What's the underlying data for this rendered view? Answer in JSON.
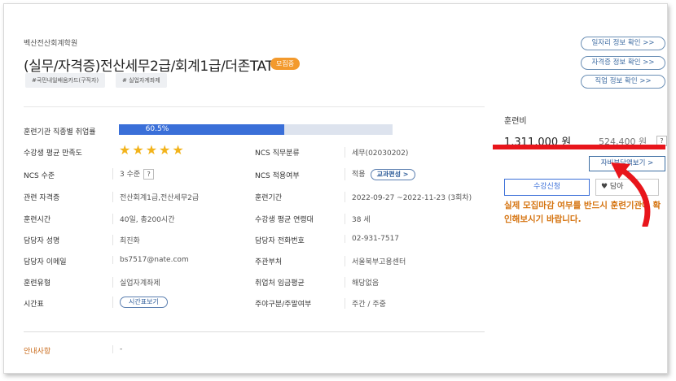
{
  "header": {
    "institution": "벡산전산회계학원",
    "title": "(실무/자격증)전산세무2급/회계1급/더존TAT",
    "badge": "모집중",
    "tags": [
      "#국민내일배움카드(구직자)",
      "# 실업자계좌제"
    ]
  },
  "links": [
    "일자리 정보 확인 >>",
    "자격증 정보 확인 >>",
    "직업 정보 확인 >>"
  ],
  "details": {
    "employment_rate_label": "훈련기관 직종별 취업률",
    "employment_rate_text": "60.5%",
    "employment_rate_value": 0.605,
    "satisfaction_label": "수강생 평균 만족도",
    "satisfaction_stars": "★★★★★",
    "satisfaction_value": 5,
    "ncs_category_label": "NCS 직무분류",
    "ncs_category_value": "세무(02030202)",
    "ncs_level_label": "NCS 수준",
    "ncs_level_value": "3 수준",
    "ncs_apply_label": "NCS 적용여부",
    "ncs_apply_value": "적용",
    "curriculum_button": "교과편성 >",
    "cert_label": "관련 자격증",
    "cert_value": "전산회계1급,전산세무2급",
    "period_label": "훈련기간",
    "period_value": "2022-09-27 ~2022-11-23 (3회차)",
    "hours_label": "훈련시간",
    "hours_value": "40일, 총200시간",
    "avg_age_label": "수강생 평균 연령대",
    "avg_age_value": "38 세",
    "manager_label": "담당자 성명",
    "manager_value": "최진화",
    "phone_label": "담당자 전화번호",
    "phone_value": "02-931-7517",
    "email_label": "담당자 이메일",
    "email_value": "bs7517@nate.com",
    "office_label": "주관부처",
    "office_value": "서울북부고용센터",
    "type_label": "훈련유형",
    "type_value": "실업자계좌제",
    "wage_label": "취업처 임금평균",
    "wage_value": "해당없음",
    "schedule_label": "시간표",
    "schedule_button": "시간표보기",
    "day_label": "주야구분/주말여부",
    "day_value": "주간 / 주중",
    "question_mark": "?"
  },
  "notice": {
    "label": "안내사항",
    "value": "-"
  },
  "fee": {
    "title": "훈련비",
    "main": "1,311,000 원",
    "sub": "524,400 원",
    "question_mark": "?",
    "self_pay_button": "자비부담액보기 >",
    "apply_button": "수강신청",
    "wish_button": "♥ 담아",
    "warning": "실제 모집마감 여부를 반드시 훈련기관에 확인해보시기 바랍니다."
  },
  "colors": {
    "bar_fill": "#3a6fd8",
    "star": "#f2b31b",
    "badge": "#f39a2d",
    "highlight_red": "#e8151b",
    "warning_text": "#d5730f"
  }
}
